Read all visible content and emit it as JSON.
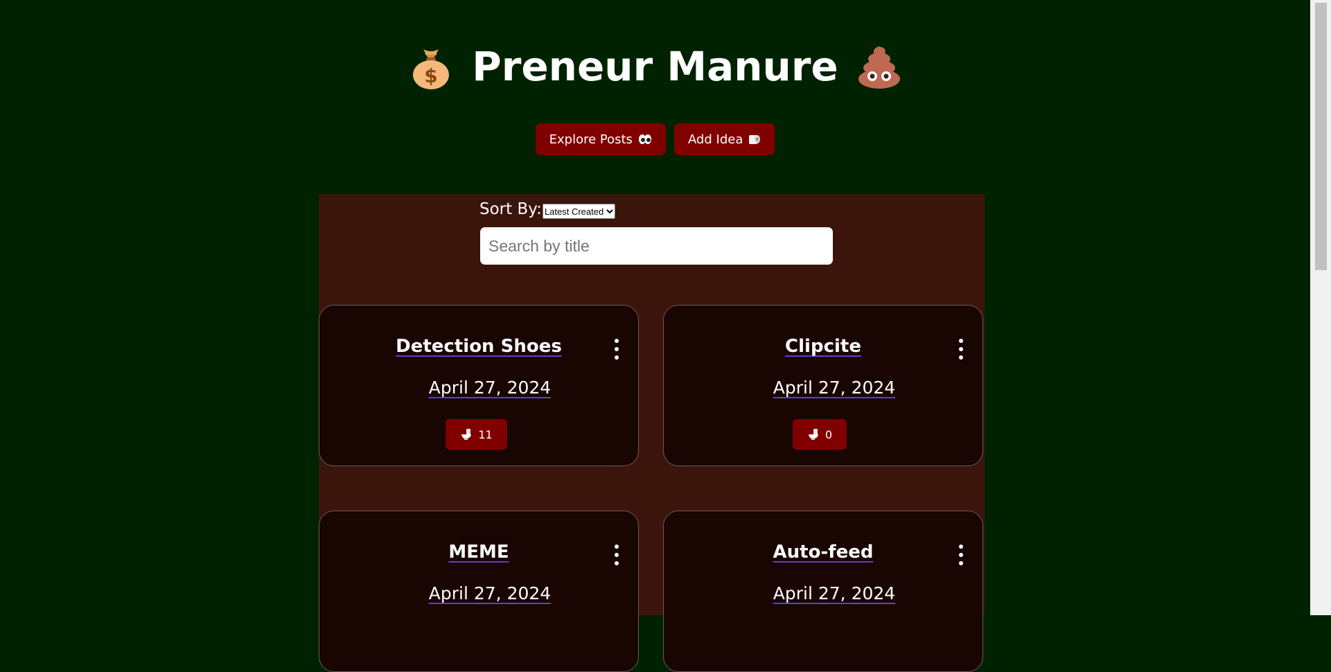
{
  "header": {
    "title": "Preneur Manure",
    "left_icon": "money-bag-icon",
    "right_icon": "poop-emoji-icon"
  },
  "nav": {
    "explore_label": "Explore Posts",
    "explore_icon": "eyes-icon",
    "add_label": "Add Idea",
    "add_icon": "toilet-paper-icon"
  },
  "toolbar": {
    "sort_label": "Sort By:",
    "sort_selected": "Latest Created",
    "search_placeholder": "Search by title"
  },
  "posts": [
    {
      "title": "Detection Shoes",
      "date": "April 27, 2024",
      "votes": "11"
    },
    {
      "title": "Clipcite",
      "date": "April 27, 2024",
      "votes": "0"
    },
    {
      "title": "MEME",
      "date": "April 27, 2024",
      "votes": ""
    },
    {
      "title": "Auto-feed",
      "date": "April 27, 2024",
      "votes": ""
    }
  ],
  "colors": {
    "background": "#002200",
    "panel": "#3b150c",
    "card": "#190603",
    "button": "#800000",
    "underline": "#5d3fd3"
  }
}
